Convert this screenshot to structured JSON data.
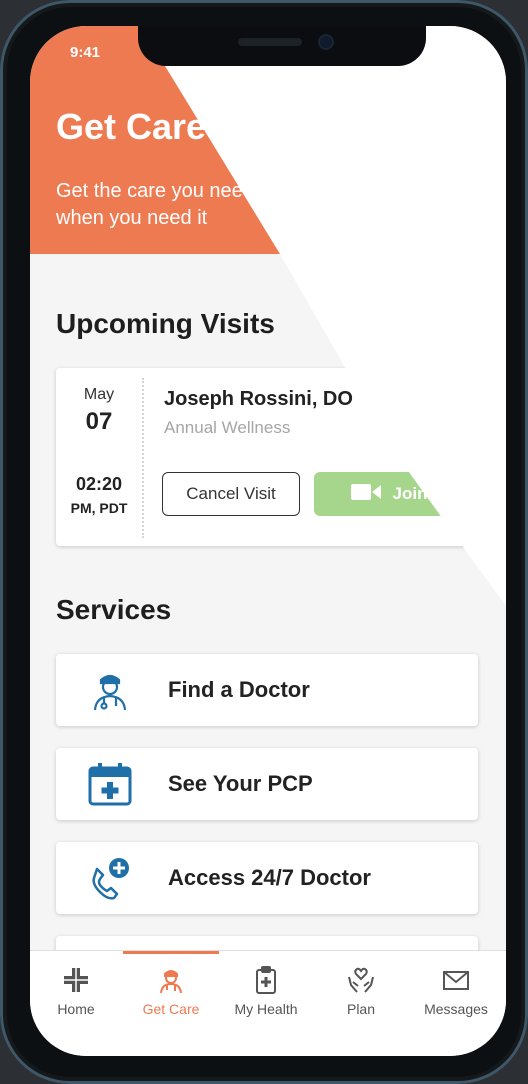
{
  "status": {
    "time": "9:41"
  },
  "header": {
    "title": "Get Care",
    "subtitle": "Get the care you need\nwhen you need it"
  },
  "upcoming": {
    "heading": "Upcoming Visits",
    "visit": {
      "month": "May",
      "day": "07",
      "time": "02:20",
      "timezone": "PM, PDT",
      "doctor": "Joseph Rossini, DO",
      "type": "Annual Wellness",
      "cancel_label": "Cancel Visit",
      "join_label": "Join"
    }
  },
  "services": {
    "heading": "Services",
    "items": [
      {
        "label": "Find a Doctor",
        "icon": "doctor-icon"
      },
      {
        "label": "See Your PCP",
        "icon": "calendar-plus-icon"
      },
      {
        "label": "Access 24/7 Doctor",
        "icon": "phone-plus-icon"
      }
    ]
  },
  "tabs": [
    {
      "label": "Home",
      "icon": "home-cross-icon",
      "active": false
    },
    {
      "label": "Get Care",
      "icon": "nurse-icon",
      "active": true
    },
    {
      "label": "My Health",
      "icon": "clipboard-icon",
      "active": false
    },
    {
      "label": "Plan",
      "icon": "hands-heart-icon",
      "active": false
    },
    {
      "label": "Messages",
      "icon": "envelope-icon",
      "active": false
    }
  ],
  "colors": {
    "brand": "#ee7a52",
    "join_button": "#a6d68c",
    "icon_blue": "#1f6fa8"
  }
}
